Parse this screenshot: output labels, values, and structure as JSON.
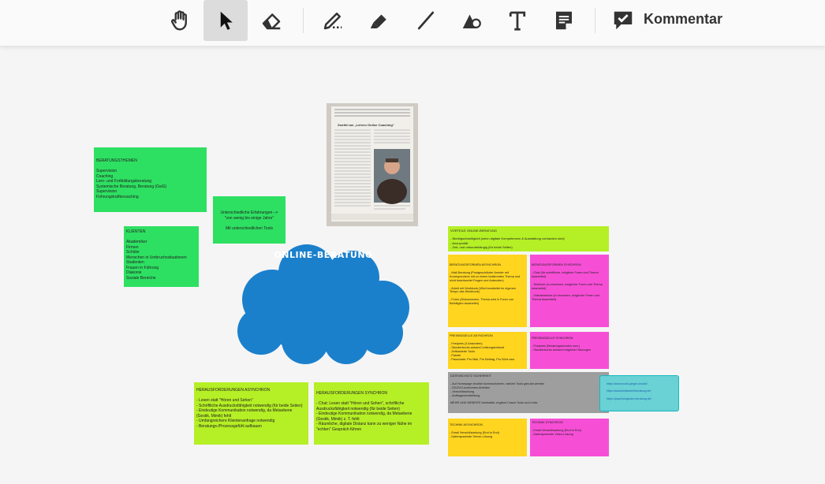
{
  "toolbar": {
    "tools": [
      "hand-tool",
      "select-tool",
      "eraser-tool",
      "pen-tool",
      "highlighter-tool",
      "line-tool",
      "shapes-tool",
      "text-tool",
      "note-tool",
      "comment-tool"
    ],
    "comment_label": "Kommentar"
  },
  "canvas": {
    "cloud_label": "ONLINE-BERATUNG",
    "notes": {
      "beratungsthemen": "BERATUNGSTHEMEN\n\nSupervision\nCoaching\nLern- und Fortbildungsberatung\nSystemische Beratung, Beratung (GwG)\nSupervision\nFührungskräftecoaching",
      "erfahrungen": "Unterschiedliche Erfahrungen –>\n\"von wenig bis einige Jahre\"\n\nMit unterschiedlichen Tools",
      "klienten": "KLIENTEN\n\nAkademiker\nFirmen\nSchüler\nMenschen in Umbruchssituationen\nStudenten\nFrauen in Führung\nDiakonie\nSoziale Bereiche",
      "herausforderungen_asynchron": "HERAUSFORDERUNGEN ASYNCHRON\n\n- Lesen statt \"Hören und Sehen\"\n- Schriftliche Ausdrucksfähigkeit notwendig (für beide Seiten)\n- Eindeutige Kommunikation notwendig, da Metaebene (Gestik, Mimik) fehlt\n- Umfangreichere Klientenanfrage notwendig\n- Beratungs-/Prozessgefühl aufbauen",
      "herausforderungen_synchron": "HERAUSFORDERUNGEN SYNCHRON\n\n- Chat: Lesen statt \"Hören und Sehen\", schriftliche Ausdrucksfähigkeit notwendig (für beide Seiten)\n- Eindeutige Kommunikation notwendig, da Metaebene (Gestik, Mimik) z. T. fehlt\n- Räumliche, digitale Distanz kann zu weniger Nähe im \"echten\" Gespräch führen",
      "vorteile": "VORTEILE ONLINE-BERATUNG\n\n- Niedrigschwelligkeit (wenn digitale Kompetenzen & Ausstattung vorhanden sind)\n- Anonymität\n- Zeit- und ortsunabhängig (für beide Seiten)",
      "beratungsformen_asynchron": "BERATUNGSFORMEN ASYNCHRON\n\n- Mail-Beratung (Postgeschützter Anrufer mit Korrespondenz mit zu einem bestimmten Thema und nicht beantwortet Fragen und Antworten)\n\n- Arbeit mit Workbook (Wird bearbeitet im eigenen Tempo das Workbook)\n\n- Foren (Diskussionen, Thema wird in Foren von Beteiligten bearbeitet)",
      "beratungsformen_synchron": "BERATUNGSFORMEN SYNCHRON\n\n- Chat (für schriftliche, mögliche Foren und Thema bearbeitet)\n\n- Telefonie (in einzelnen, möglicher Foren und Thema bearbeitet)\n\n- Videotelefonie (in einzelnen, möglicher Foren und Thema bearbeitet)",
      "preismodelle_asynchron": "PREISMODELLE ASYNCHRON\n\n- Festpreis (3 Antworten)\n- Stundenkonto anhand Leistungsentwurf\n- Zeitbasierte Tools\n- Pakete\n- Pauschale: Pro Mail, Pro Beitrag, Pro Wort usw.",
      "preismodelle_synchron": "PREISMODELLE SYNCHRON\n\n- Festpreis (Beratungsstunden usw.)\n- Stundenkonto anhand möglicher Sitzungen",
      "datenschutz": "DATENSCHUTZ SICHERHEIT\n\n- Auf Homepage deutlich kommunizieren, welche Tools genutzt werden\n- DSGVO-konformes Arbeiten\n- Verschlüsselung\n- Auftragsverarbeitung\n\nMEHR UND WEBSITE beinhaltet, ergänzt Coach-Tools und Links",
      "links": "https://www.ecole-jaeger.ceo/de/\n\nhttps://www.fiwikisberhberatung.de/\n\nhttps://psychologische-beratung.de/",
      "technik_asynchron": "TECHNIK ASYNCHRON\n\n- Email Verschlüsselung (End to End)\n- Datensparende Server-Lösung",
      "technik_synchron": "TECHNIK SYNCHRON\n\n- Email Verschlüsselung (End to End)\n- Datensparende Video-Lösung"
    },
    "article": {
      "title": "Zweifel am „Lehren Online Coaching“"
    }
  }
}
